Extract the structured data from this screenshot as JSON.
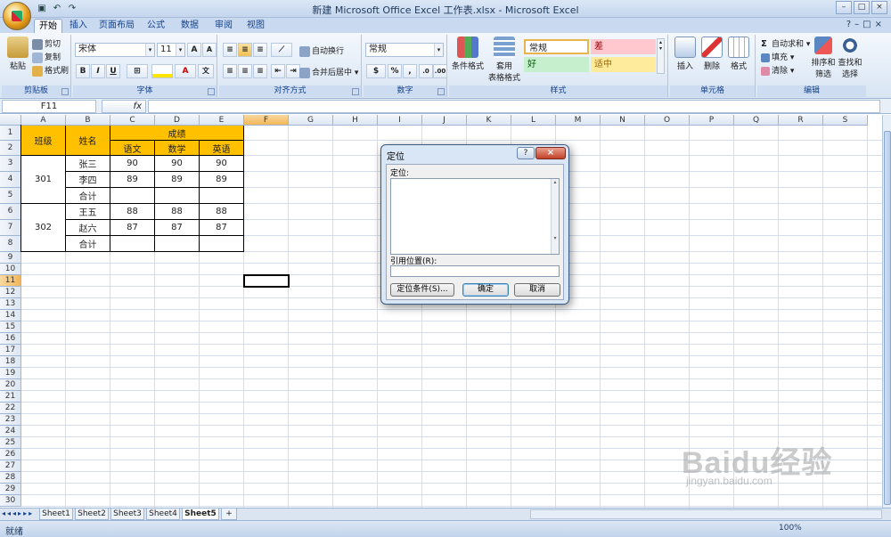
{
  "window": {
    "title": "新建 Microsoft Office Excel 工作表.xlsx - Microsoft Excel",
    "controls": [
      "–",
      "□",
      "×"
    ]
  },
  "tabs": [
    "开始",
    "插入",
    "页面布局",
    "公式",
    "数据",
    "审阅",
    "视图"
  ],
  "ribbon": {
    "clipboard": {
      "paste": "粘贴",
      "cut": "剪切",
      "copy": "复制",
      "format_painter": "格式刷",
      "label": "剪贴板"
    },
    "font": {
      "name": "宋体",
      "size": "11",
      "label": "字体",
      "bold": "B",
      "italic": "I",
      "underline": "U"
    },
    "alignment": {
      "wrap": "自动换行",
      "merge": "合并后居中",
      "label": "对齐方式"
    },
    "number": {
      "format": "常规",
      "label": "数字"
    },
    "styles": {
      "conditional": "条件格式",
      "table_format_1": "套用",
      "table_format_2": "表格格式",
      "cell_normal": "常规",
      "cell_bad": "差",
      "cell_good": "好",
      "cell_neutral": "适中",
      "label": "样式"
    },
    "cells": {
      "insert": "插入",
      "delete": "删除",
      "format": "格式",
      "label": "单元格"
    },
    "editing": {
      "autosum": "自动求和",
      "fill": "填充",
      "clear": "清除",
      "sort_1": "排序和",
      "sort_2": "筛选",
      "find_1": "查找和",
      "find_2": "选择",
      "label": "编辑"
    }
  },
  "formula_bar": {
    "name_box": "F11",
    "fx": "fx",
    "formula": ""
  },
  "columns": [
    "A",
    "B",
    "C",
    "D",
    "E",
    "F",
    "G",
    "H",
    "I",
    "J",
    "K",
    "L",
    "M",
    "N",
    "O",
    "P",
    "Q",
    "R",
    "S"
  ],
  "rows": [
    "1",
    "2",
    "3",
    "4",
    "5",
    "6",
    "7",
    "8",
    "9",
    "10",
    "11",
    "12",
    "13",
    "14",
    "15",
    "16",
    "17",
    "18",
    "19",
    "20",
    "21",
    "22",
    "23",
    "24",
    "25",
    "26",
    "27",
    "28",
    "29",
    "30"
  ],
  "table": {
    "class_header": "班级",
    "name_header": "姓名",
    "scores_header": "成绩",
    "subjects": [
      "语文",
      "数学",
      "英语"
    ],
    "groups": [
      {
        "class": "301",
        "rows": [
          {
            "name": "张三",
            "scores": [
              "90",
              "90",
              "90"
            ]
          },
          {
            "name": "李四",
            "scores": [
              "89",
              "89",
              "89"
            ]
          },
          {
            "name": "合计",
            "scores": [
              "",
              "",
              ""
            ]
          }
        ]
      },
      {
        "class": "302",
        "rows": [
          {
            "name": "王五",
            "scores": [
              "88",
              "88",
              "88"
            ]
          },
          {
            "name": "赵六",
            "scores": [
              "87",
              "87",
              "87"
            ]
          },
          {
            "name": "合计",
            "scores": [
              "",
              "",
              ""
            ]
          }
        ]
      }
    ]
  },
  "sheets": [
    "Sheet1",
    "Sheet2",
    "Sheet3",
    "Sheet4",
    "Sheet5"
  ],
  "active_sheet": "Sheet5",
  "status": {
    "ready": "就绪",
    "zoom": "100%"
  },
  "dialog": {
    "title": "定位",
    "help": "?",
    "close": "×",
    "goto_label": "定位:",
    "reference_label": "引用位置(R):",
    "special_button": "定位条件(S)...",
    "ok_button": "确定",
    "cancel_button": "取消",
    "reference_value": ""
  },
  "watermark": {
    "main": "Baidu经验",
    "sub": "jingyan.baidu.com"
  }
}
